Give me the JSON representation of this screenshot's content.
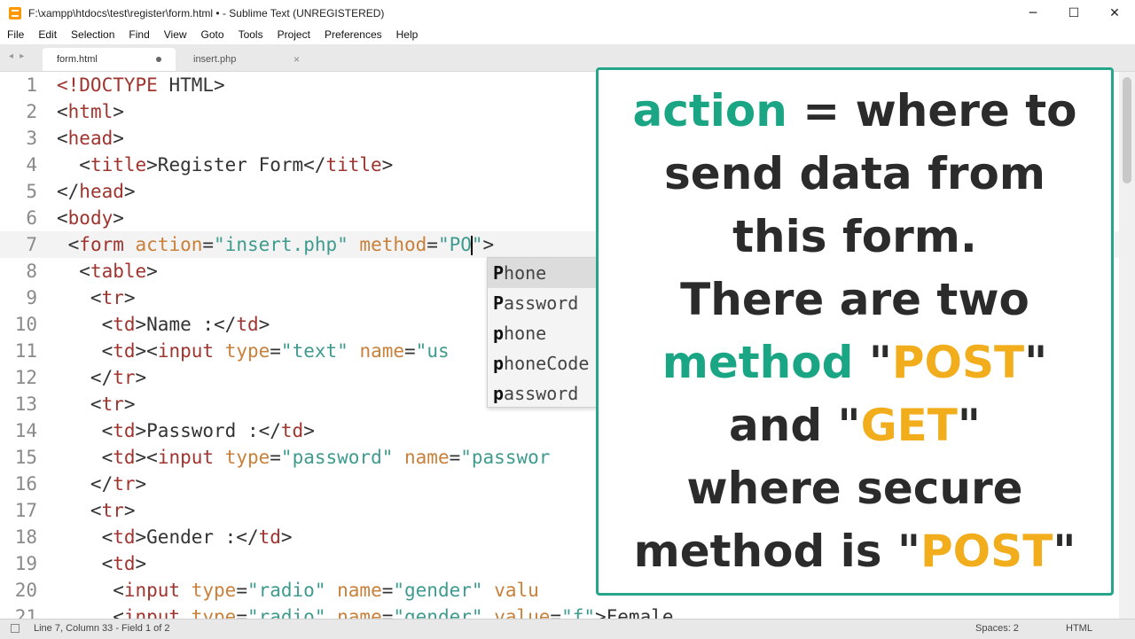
{
  "window": {
    "title": "F:\\xampp\\htdocs\\test\\register\\form.html • - Sublime Text (UNREGISTERED)",
    "controls": {
      "minimize": "─",
      "maximize": "☐",
      "close": "✕"
    }
  },
  "menu": [
    "File",
    "Edit",
    "Selection",
    "Find",
    "View",
    "Goto",
    "Tools",
    "Project",
    "Preferences",
    "Help"
  ],
  "tabs": [
    {
      "label": "form.html",
      "active": true,
      "modified": true
    },
    {
      "label": "insert.php",
      "active": false,
      "modified": false
    }
  ],
  "tab_close_glyph": "×",
  "tab_nav_glyph": "◂ ▸",
  "editor": {
    "current_line": 7,
    "lines": [
      {
        "n": "1",
        "tokens": [
          [
            "tag",
            "<!DOCTYPE"
          ],
          [
            "text",
            " HTML>"
          ]
        ]
      },
      {
        "n": "2",
        "tokens": [
          [
            "text",
            "<"
          ],
          [
            "tag",
            "html"
          ],
          [
            "text",
            ">"
          ]
        ]
      },
      {
        "n": "3",
        "tokens": [
          [
            "text",
            "<"
          ],
          [
            "tag",
            "head"
          ],
          [
            "text",
            ">"
          ]
        ]
      },
      {
        "n": "4",
        "tokens": [
          [
            "text",
            "  <"
          ],
          [
            "tag",
            "title"
          ],
          [
            "text",
            ">Register Form</"
          ],
          [
            "tag",
            "title"
          ],
          [
            "text",
            ">"
          ]
        ]
      },
      {
        "n": "5",
        "tokens": [
          [
            "text",
            "</"
          ],
          [
            "tag",
            "head"
          ],
          [
            "text",
            ">"
          ]
        ]
      },
      {
        "n": "6",
        "tokens": [
          [
            "text",
            "<"
          ],
          [
            "tag",
            "body"
          ],
          [
            "text",
            ">"
          ]
        ]
      },
      {
        "n": "7",
        "tokens": [
          [
            "text",
            " <"
          ],
          [
            "tag",
            "form"
          ],
          [
            "text",
            " "
          ],
          [
            "attr",
            "action"
          ],
          [
            "text",
            "="
          ],
          [
            "str",
            "\"insert.php\""
          ],
          [
            "text",
            " "
          ],
          [
            "attr",
            "method"
          ],
          [
            "text",
            "="
          ],
          [
            "str",
            "\"PO"
          ],
          [
            "cursor",
            ""
          ],
          [
            "str",
            "\""
          ],
          [
            "text",
            ">"
          ]
        ]
      },
      {
        "n": "8",
        "tokens": [
          [
            "text",
            "  <"
          ],
          [
            "tag",
            "table"
          ],
          [
            "text",
            ">"
          ]
        ]
      },
      {
        "n": "9",
        "tokens": [
          [
            "text",
            "   <"
          ],
          [
            "tag",
            "tr"
          ],
          [
            "text",
            ">"
          ]
        ]
      },
      {
        "n": "10",
        "tokens": [
          [
            "text",
            "    <"
          ],
          [
            "tag",
            "td"
          ],
          [
            "text",
            ">Name :</"
          ],
          [
            "tag",
            "td"
          ],
          [
            "text",
            ">"
          ]
        ]
      },
      {
        "n": "11",
        "tokens": [
          [
            "text",
            "    <"
          ],
          [
            "tag",
            "td"
          ],
          [
            "text",
            "><"
          ],
          [
            "tag",
            "input"
          ],
          [
            "text",
            " "
          ],
          [
            "attr",
            "type"
          ],
          [
            "text",
            "="
          ],
          [
            "str",
            "\"text\""
          ],
          [
            "text",
            " "
          ],
          [
            "attr",
            "name"
          ],
          [
            "text",
            "="
          ],
          [
            "str",
            "\"us"
          ]
        ]
      },
      {
        "n": "12",
        "tokens": [
          [
            "text",
            "   </"
          ],
          [
            "tag",
            "tr"
          ],
          [
            "text",
            ">"
          ]
        ]
      },
      {
        "n": "13",
        "tokens": [
          [
            "text",
            "   <"
          ],
          [
            "tag",
            "tr"
          ],
          [
            "text",
            ">"
          ]
        ]
      },
      {
        "n": "14",
        "tokens": [
          [
            "text",
            "    <"
          ],
          [
            "tag",
            "td"
          ],
          [
            "text",
            ">Password :</"
          ],
          [
            "tag",
            "td"
          ],
          [
            "text",
            ">"
          ]
        ]
      },
      {
        "n": "15",
        "tokens": [
          [
            "text",
            "    <"
          ],
          [
            "tag",
            "td"
          ],
          [
            "text",
            "><"
          ],
          [
            "tag",
            "input"
          ],
          [
            "text",
            " "
          ],
          [
            "attr",
            "type"
          ],
          [
            "text",
            "="
          ],
          [
            "str",
            "\"password\""
          ],
          [
            "text",
            " "
          ],
          [
            "attr",
            "name"
          ],
          [
            "text",
            "="
          ],
          [
            "str",
            "\"passwor"
          ]
        ]
      },
      {
        "n": "16",
        "tokens": [
          [
            "text",
            "   </"
          ],
          [
            "tag",
            "tr"
          ],
          [
            "text",
            ">"
          ]
        ]
      },
      {
        "n": "17",
        "tokens": [
          [
            "text",
            "   <"
          ],
          [
            "tag",
            "tr"
          ],
          [
            "text",
            ">"
          ]
        ]
      },
      {
        "n": "18",
        "tokens": [
          [
            "text",
            "    <"
          ],
          [
            "tag",
            "td"
          ],
          [
            "text",
            ">Gender :</"
          ],
          [
            "tag",
            "td"
          ],
          [
            "text",
            ">"
          ]
        ]
      },
      {
        "n": "19",
        "tokens": [
          [
            "text",
            "    <"
          ],
          [
            "tag",
            "td"
          ],
          [
            "text",
            ">"
          ]
        ]
      },
      {
        "n": "20",
        "tokens": [
          [
            "text",
            "     <"
          ],
          [
            "tag",
            "input"
          ],
          [
            "text",
            " "
          ],
          [
            "attr",
            "type"
          ],
          [
            "text",
            "="
          ],
          [
            "str",
            "\"radio\""
          ],
          [
            "text",
            " "
          ],
          [
            "attr",
            "name"
          ],
          [
            "text",
            "="
          ],
          [
            "str",
            "\"gender\""
          ],
          [
            "text",
            " "
          ],
          [
            "attr",
            "valu"
          ]
        ]
      },
      {
        "n": "21",
        "tokens": [
          [
            "text",
            "     <"
          ],
          [
            "tag",
            "input"
          ],
          [
            "text",
            " "
          ],
          [
            "attr",
            "type"
          ],
          [
            "text",
            "="
          ],
          [
            "str",
            "\"radio\""
          ],
          [
            "text",
            " "
          ],
          [
            "attr",
            "name"
          ],
          [
            "text",
            "="
          ],
          [
            "str",
            "\"gender\""
          ],
          [
            "text",
            " "
          ],
          [
            "attr",
            "value"
          ],
          [
            "text",
            "="
          ],
          [
            "str",
            "\"f\""
          ],
          [
            "text",
            ">Female"
          ]
        ]
      }
    ]
  },
  "autocomplete": {
    "typed_prefix": "P",
    "items": [
      {
        "bold": "P",
        "rest": "hone",
        "selected": true
      },
      {
        "bold": "P",
        "rest": "assword",
        "selected": false
      },
      {
        "bold": "p",
        "rest": "hone",
        "selected": false
      },
      {
        "bold": "p",
        "rest": "honeCode",
        "selected": false
      },
      {
        "bold": "p",
        "rest": "assword",
        "selected": false
      }
    ]
  },
  "overlay": {
    "lines": [
      [
        [
          "green",
          "action"
        ],
        [
          "plain",
          " = where to"
        ]
      ],
      [
        [
          "plain",
          "send data from"
        ]
      ],
      [
        [
          "plain",
          "this form."
        ]
      ],
      [
        [
          "plain",
          "There are two"
        ]
      ],
      [
        [
          "green",
          "method"
        ],
        [
          "plain",
          " \""
        ],
        [
          "orange",
          "POST"
        ],
        [
          "plain",
          "\""
        ]
      ],
      [
        [
          "plain",
          "and \""
        ],
        [
          "orange",
          "GET"
        ],
        [
          "plain",
          "\""
        ]
      ],
      [
        [
          "plain",
          "where secure"
        ]
      ],
      [
        [
          "plain",
          "method is \""
        ],
        [
          "orange",
          "POST"
        ],
        [
          "plain",
          "\""
        ]
      ]
    ],
    "colors": {
      "border": "#27a58a",
      "green": "#1aa684",
      "orange": "#f2ad1c",
      "text": "#2b2b2b"
    }
  },
  "status": {
    "position": "Line 7, Column 33 - Field 1 of 2",
    "spaces": "Spaces: 2",
    "syntax": "HTML"
  },
  "syntax_colors": {
    "tag": "#a0342e",
    "attr": "#c8803a",
    "string": "#3e9b8e",
    "text": "#333333"
  }
}
